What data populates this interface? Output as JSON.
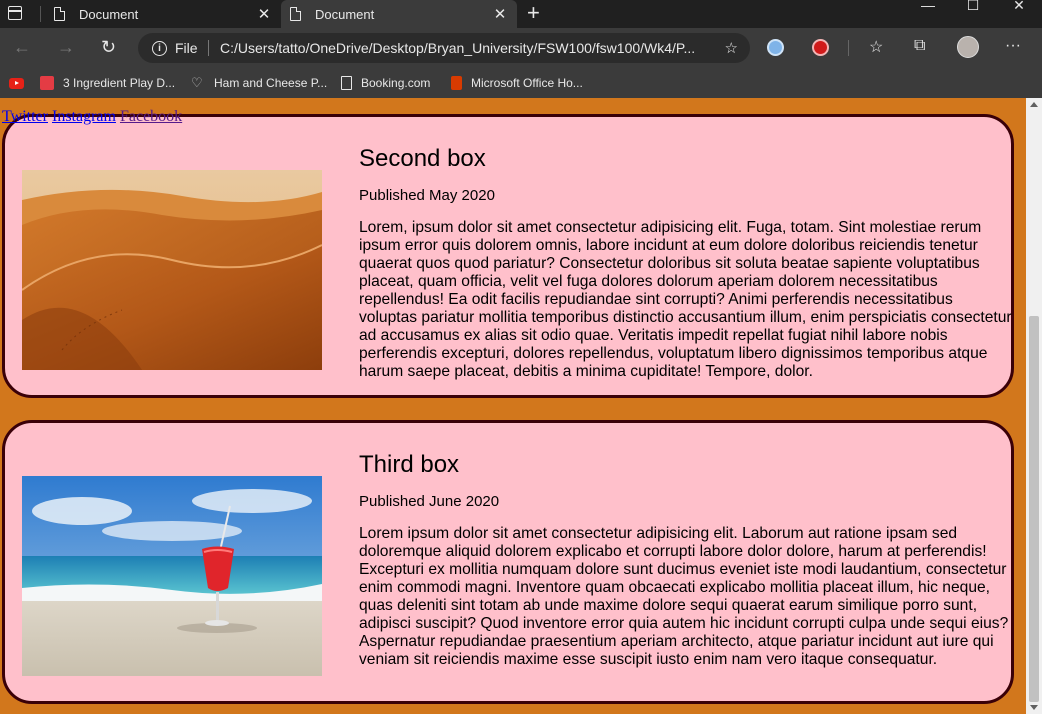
{
  "browser": {
    "tabs": [
      {
        "title": "Document",
        "close": "✕"
      },
      {
        "title": "Document",
        "close": "✕"
      }
    ],
    "new_tab": "+",
    "window_controls": {
      "minimize": "—",
      "maximize": "☐",
      "close": "✕"
    },
    "address": {
      "scheme_label": "File",
      "url": "C:/Users/tatto/OneDrive/Desktop/Bryan_University/FSW100/fsw100/Wk4/P..."
    },
    "nav": {
      "back": "←",
      "forward": "→",
      "refresh": "↻",
      "more": "···"
    },
    "favorites": [
      {
        "label": "",
        "icon": "youtube-icon"
      },
      {
        "label": "3 Ingredient Play D...",
        "icon": "recipe-icon"
      },
      {
        "label": "Ham and Cheese P...",
        "icon": "heart-icon"
      },
      {
        "label": "Booking.com",
        "icon": "document-icon"
      },
      {
        "label": "Microsoft Office Ho...",
        "icon": "office-icon"
      }
    ],
    "colors": {
      "chrome_dark": "#202020",
      "chrome": "#3b3b3b"
    }
  },
  "page": {
    "links": [
      "Twitter",
      "Instagram",
      "Facebook"
    ],
    "colors": {
      "background": "#d2771c",
      "card": "#ffc0cb",
      "border": "#3a0008"
    },
    "cards": [
      {
        "title": "Second box",
        "published": "Published May 2020",
        "image": "desert-dunes-image",
        "body": "Lorem, ipsum dolor sit amet consectetur adipisicing elit. Fuga, totam. Sint molestiae rerum ipsum error quis dolorem omnis, labore incidunt at eum dolore doloribus reiciendis tenetur quaerat quos quod pariatur? Consectetur doloribus sit soluta beatae sapiente voluptatibus placeat, quam officia, velit vel fuga dolores dolorum aperiam dolorem necessitatibus repellendus! Ea odit facilis repudiandae sint corrupti? Animi perferendis necessitatibus voluptas pariatur mollitia temporibus distinctio accusantium illum, enim perspiciatis consectetur ad accusamus ex alias sit odio quae. Veritatis impedit repellat fugiat nihil labore nobis perferendis excepturi, dolores repellendus, voluptatum libero dignissimos temporibus atque harum saepe placeat, debitis a minima cupiditate! Tempore, dolor."
      },
      {
        "title": "Third box",
        "published": "Published June 2020",
        "image": "beach-cocktail-image",
        "body": "Lorem ipsum dolor sit amet consectetur adipisicing elit. Laborum aut ratione ipsam sed doloremque aliquid dolorem explicabo et corrupti labore dolor dolore, harum at perferendis! Excepturi ex mollitia numquam dolore sunt ducimus eveniet iste modi laudantium, consectetur enim commodi magni. Inventore quam obcaecati explicabo mollitia placeat illum, hic neque, quas deleniti sint totam ab unde maxime dolore sequi quaerat earum similique porro sunt, adipisci suscipit? Quod inventore error quia autem hic incidunt corrupti culpa unde sequi eius? Aspernatur repudiandae praesentium aperiam architecto, atque pariatur incidunt aut iure qui veniam sit reiciendis maxime esse suscipit iusto enim nam vero itaque consequatur."
      }
    ]
  }
}
